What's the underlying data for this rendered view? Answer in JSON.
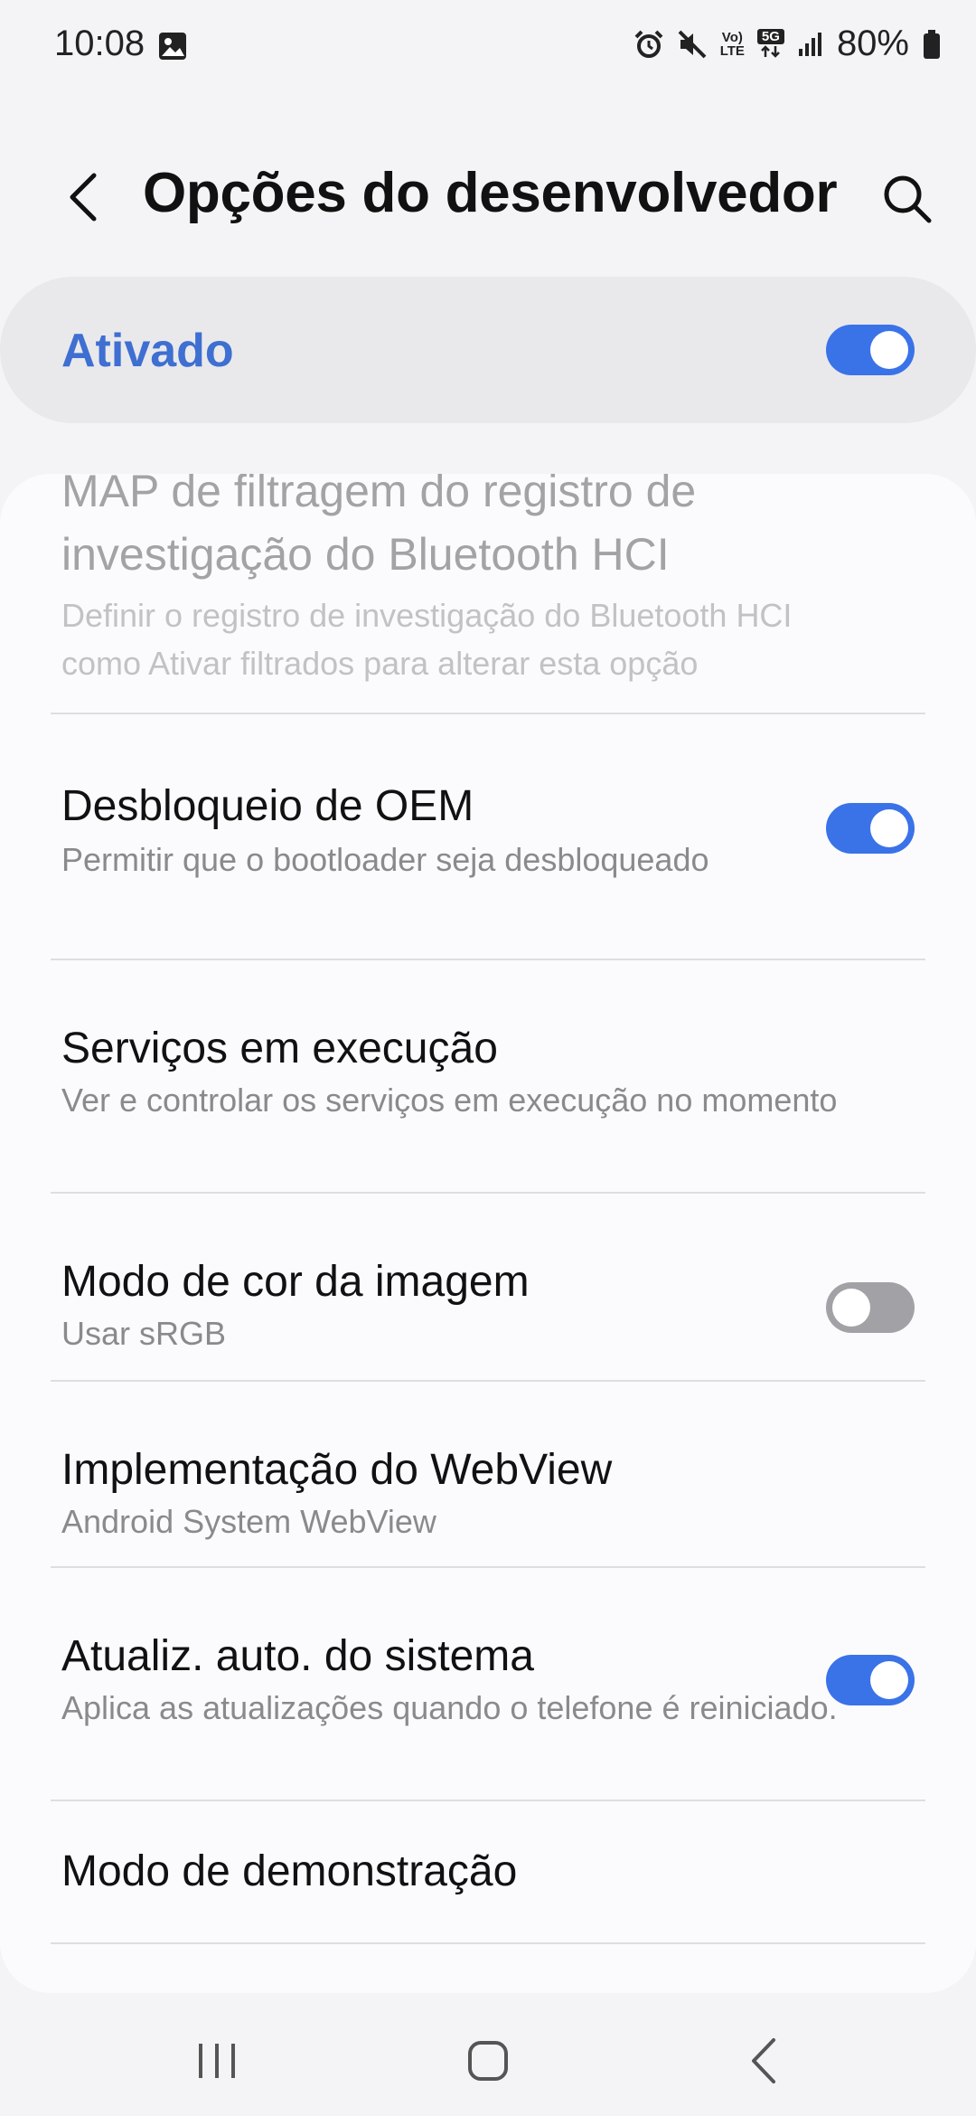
{
  "status_bar": {
    "time": "10:08",
    "battery": "80%",
    "network_tag_volte_top": "Vo)",
    "network_tag_volte_bottom": "LTE",
    "network_tag_5g": "5G",
    "icons": [
      "image-icon",
      "alarm-icon",
      "mute-icon",
      "volte-icon",
      "5g-icon",
      "signal-icon",
      "battery-icon"
    ]
  },
  "header": {
    "title": "Opções do desenvolvedor",
    "back_icon": "back-icon",
    "search_icon": "search-icon"
  },
  "master_switch": {
    "label": "Ativado",
    "state": true,
    "accent_color": "#3e6fd1"
  },
  "settings": [
    {
      "title": "MAP de filtragem do registro de investigação do Bluetooth HCI",
      "subtitle": "Definir o registro de investigação do Bluetooth HCI como Ativar filtrados para alterar esta opção",
      "enabled": false,
      "has_toggle": false
    },
    {
      "title": "Desbloqueio de OEM",
      "subtitle": "Permitir que o bootloader seja desbloqueado",
      "has_toggle": true,
      "toggle_state": true
    },
    {
      "title": "Serviços em execução",
      "subtitle": "Ver e controlar os serviços em execução no momento",
      "has_toggle": false
    },
    {
      "title": "Modo de cor da imagem",
      "subtitle": "Usar sRGB",
      "has_toggle": true,
      "toggle_state": false
    },
    {
      "title": "Implementação do WebView",
      "subtitle": "Android System WebView",
      "has_toggle": false
    },
    {
      "title": "Atualiz. auto. do sistema",
      "subtitle": "Aplica as atualizações quando o telefone é reiniciado.",
      "has_toggle": true,
      "toggle_state": true
    },
    {
      "title": "Modo de demonstração",
      "has_toggle": false
    }
  ],
  "nav_bar": {
    "icons": [
      "recents-icon",
      "home-icon",
      "back-nav-icon"
    ]
  },
  "colors": {
    "toggle_on": "#3a72e8",
    "toggle_off": "#a2a2a6",
    "background": "#f4f4f6"
  }
}
